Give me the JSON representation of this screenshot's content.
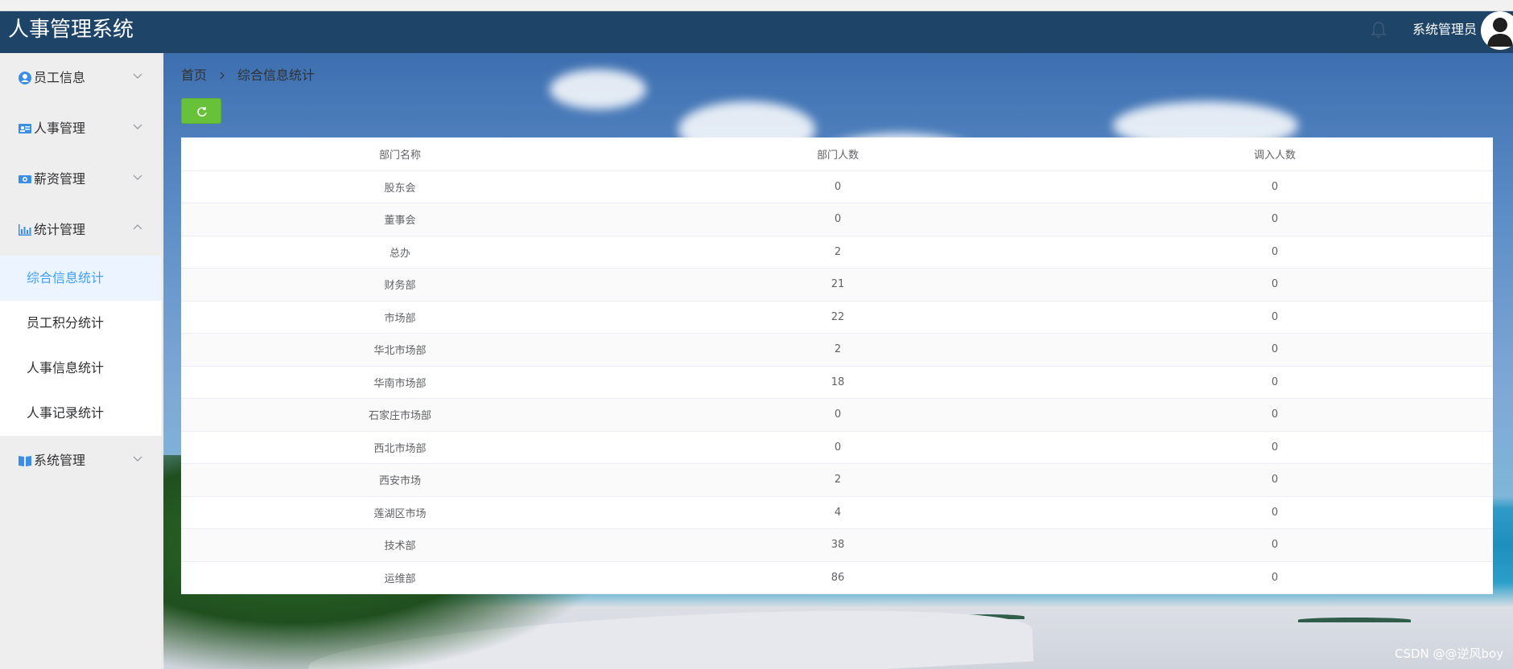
{
  "header": {
    "title": "人事管理系统",
    "username": "系统管理员"
  },
  "sidebar": {
    "groups": [
      {
        "label": "员工信息",
        "icon": "user-circle-icon"
      },
      {
        "label": "人事管理",
        "icon": "id-card-icon"
      },
      {
        "label": "薪资管理",
        "icon": "money-icon"
      },
      {
        "label": "统计管理",
        "icon": "bar-chart-icon",
        "expanded": true,
        "items": [
          {
            "label": "综合信息统计",
            "active": true
          },
          {
            "label": "员工积分统计"
          },
          {
            "label": "人事信息统计"
          },
          {
            "label": "人事记录统计"
          }
        ]
      },
      {
        "label": "系统管理",
        "icon": "book-icon"
      }
    ]
  },
  "breadcrumb": {
    "home": "首页",
    "current": "综合信息统计"
  },
  "table": {
    "columns": [
      "部门名称",
      "部门人数",
      "调入人数"
    ],
    "rows": [
      [
        "股东会",
        "0",
        "0"
      ],
      [
        "董事会",
        "0",
        "0"
      ],
      [
        "总办",
        "2",
        "0"
      ],
      [
        "财务部",
        "21",
        "0"
      ],
      [
        "市场部",
        "22",
        "0"
      ],
      [
        "华北市场部",
        "2",
        "0"
      ],
      [
        "华南市场部",
        "18",
        "0"
      ],
      [
        "石家庄市场部",
        "0",
        "0"
      ],
      [
        "西北市场部",
        "0",
        "0"
      ],
      [
        "西安市场",
        "2",
        "0"
      ],
      [
        "莲湖区市场",
        "4",
        "0"
      ],
      [
        "技术部",
        "38",
        "0"
      ],
      [
        "运维部",
        "86",
        "0"
      ]
    ]
  },
  "watermark": "CSDN @@逆风boy",
  "colors": {
    "header_bg": "#1e4568",
    "accent": "#409eff",
    "refresh_button": "#67c23a"
  }
}
